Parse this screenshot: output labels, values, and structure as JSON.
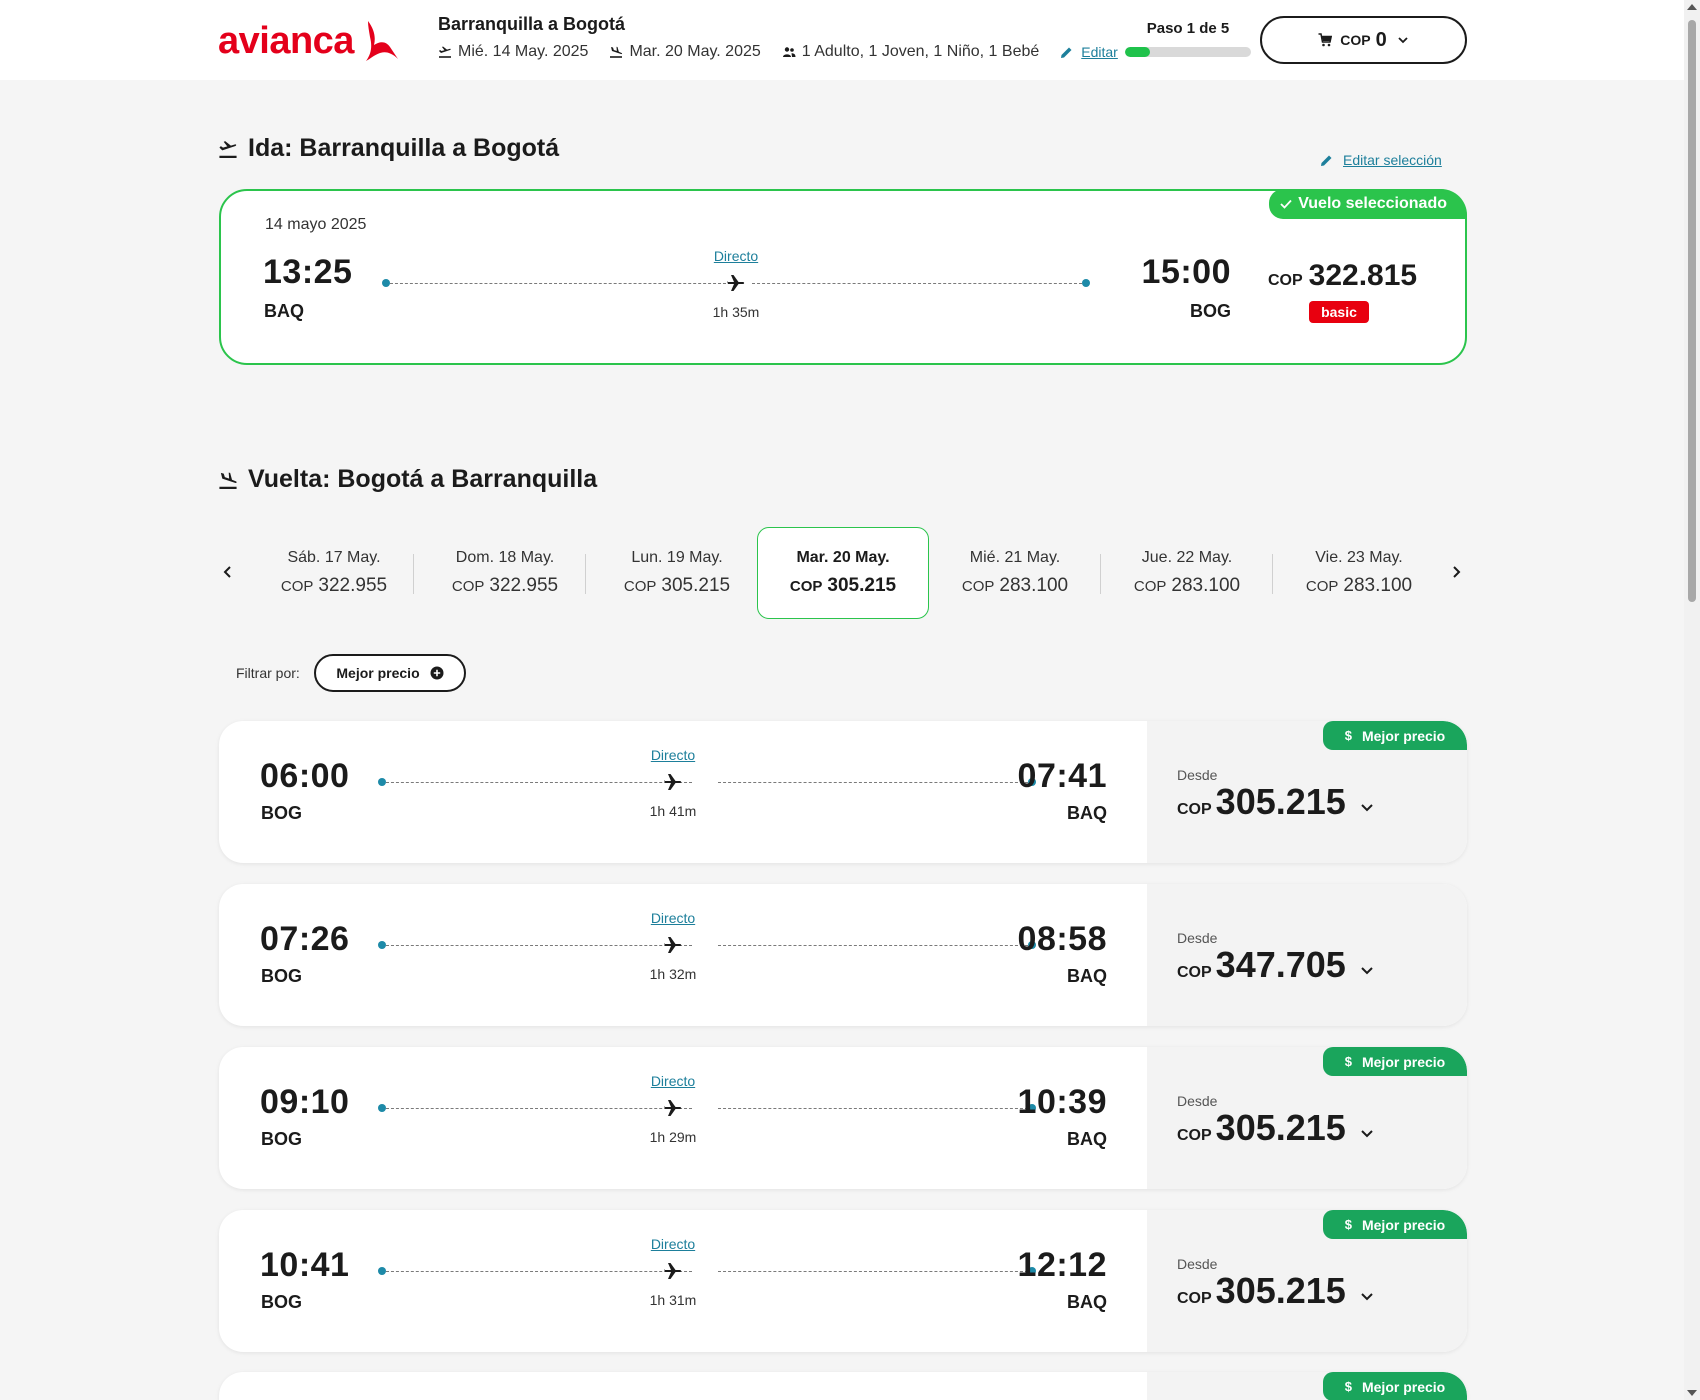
{
  "header": {
    "logo_text": "avianca",
    "trip_title": "Barranquilla a Bogotá",
    "departure_date": "Mié. 14 May. 2025",
    "return_date": "Mar. 20 May. 2025",
    "passengers": "1 Adulto, 1 Joven, 1 Niño, 1 Bebé",
    "edit_label": "Editar",
    "step_label": "Paso 1 de 5",
    "step_progress": 0.2,
    "cart_currency": "COP",
    "cart_amount": "0"
  },
  "outbound": {
    "title": "Ida: Barranquilla a Bogotá",
    "edit_selection_label": "Editar selección",
    "badge": "Vuelo seleccionado",
    "date": "14 mayo 2025",
    "depart_time": "13:25",
    "depart_code": "BAQ",
    "arrive_time": "15:00",
    "arrive_code": "BOG",
    "stops": "Directo",
    "duration": "1h 35m",
    "currency": "COP",
    "price": "322.815",
    "fare": "basic"
  },
  "return": {
    "title": "Vuelta: Bogotá a Barranquilla",
    "dates": [
      {
        "label": "Sáb. 17 May.",
        "currency": "COP",
        "price": "322.955"
      },
      {
        "label": "Dom. 18 May.",
        "currency": "COP",
        "price": "322.955"
      },
      {
        "label": "Lun. 19 May.",
        "currency": "COP",
        "price": "305.215"
      },
      {
        "label": "Mar. 20 May.",
        "currency": "COP",
        "price": "305.215"
      },
      {
        "label": "Mié. 21 May.",
        "currency": "COP",
        "price": "283.100"
      },
      {
        "label": "Jue. 22 May.",
        "currency": "COP",
        "price": "283.100"
      },
      {
        "label": "Vie. 23 May.",
        "currency": "COP",
        "price": "283.100"
      }
    ],
    "active_date_index": 3,
    "filter_label": "Filtrar por:",
    "filter_button": "Mejor precio",
    "flights": [
      {
        "depart_time": "06:00",
        "depart_code": "BOG",
        "arrive_time": "07:41",
        "arrive_code": "BAQ",
        "stops": "Directo",
        "duration": "1h 41m",
        "from_label": "Desde",
        "currency": "COP",
        "price": "305.215",
        "badge": "Mejor precio"
      },
      {
        "depart_time": "07:26",
        "depart_code": "BOG",
        "arrive_time": "08:58",
        "arrive_code": "BAQ",
        "stops": "Directo",
        "duration": "1h 32m",
        "from_label": "Desde",
        "currency": "COP",
        "price": "347.705",
        "badge": ""
      },
      {
        "depart_time": "09:10",
        "depart_code": "BOG",
        "arrive_time": "10:39",
        "arrive_code": "BAQ",
        "stops": "Directo",
        "duration": "1h 29m",
        "from_label": "Desde",
        "currency": "COP",
        "price": "305.215",
        "badge": "Mejor precio"
      },
      {
        "depart_time": "10:41",
        "depart_code": "BOG",
        "arrive_time": "12:12",
        "arrive_code": "BAQ",
        "stops": "Directo",
        "duration": "1h 31m",
        "from_label": "Desde",
        "currency": "COP",
        "price": "305.215",
        "badge": "Mejor precio"
      },
      {
        "badge": "Mejor precio"
      }
    ]
  },
  "colors": {
    "brand_red": "#e4001b",
    "selected_green": "#2bc44c",
    "best_price_green": "#1aa55c",
    "link_teal": "#1d7f9b",
    "fare_basic_red": "#e8000f"
  },
  "icons": {
    "plane_takeoff": "plane-takeoff-icon",
    "plane_landing": "plane-landing-icon",
    "passengers": "users-icon",
    "edit": "pencil-icon",
    "cart": "cart-icon",
    "chevron": "chevron-down-icon",
    "check": "check-icon",
    "plane": "plane-icon",
    "plus_circle": "plus-circle-icon",
    "dollar": "dollar-icon"
  }
}
